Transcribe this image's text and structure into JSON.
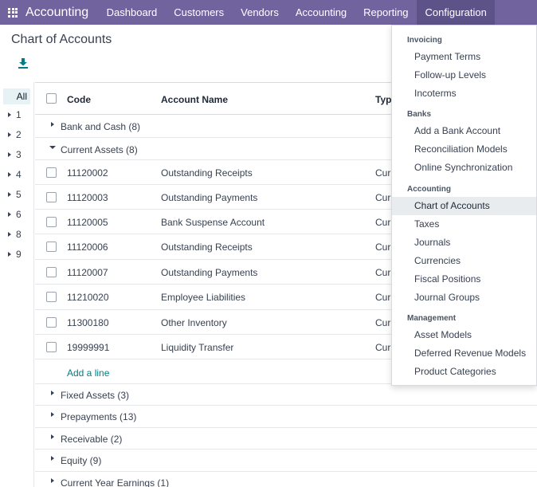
{
  "topbar": {
    "brand": "Accounting",
    "menu": [
      "Dashboard",
      "Customers",
      "Vendors",
      "Accounting",
      "Reporting",
      "Configuration"
    ]
  },
  "page": {
    "title": "Chart of Accounts"
  },
  "sidebar": {
    "all": "All",
    "items": [
      "1",
      "2",
      "3",
      "4",
      "5",
      "6",
      "8",
      "9"
    ]
  },
  "table": {
    "headers": {
      "code": "Code",
      "name": "Account Name",
      "type": "Typ"
    },
    "groups": [
      {
        "label": "Bank and Cash (8)"
      },
      {
        "label": "Current Assets (8)"
      }
    ],
    "rows": [
      {
        "code": "11120002",
        "name": "Outstanding Receipts",
        "type": "Curr"
      },
      {
        "code": "11120003",
        "name": "Outstanding Payments",
        "type": "Curr"
      },
      {
        "code": "11120005",
        "name": "Bank Suspense Account",
        "type": "Curr"
      },
      {
        "code": "11120006",
        "name": "Outstanding Receipts",
        "type": "Curr"
      },
      {
        "code": "11120007",
        "name": "Outstanding Payments",
        "type": "Curr"
      },
      {
        "code": "11210020",
        "name": "Employee Liabilities",
        "type": "Curr"
      },
      {
        "code": "11300180",
        "name": "Other Inventory",
        "type": "Curr"
      },
      {
        "code": "19999991",
        "name": "Liquidity Transfer",
        "type": "Curr"
      }
    ],
    "add_line": "Add a line",
    "more_groups": [
      {
        "label": "Fixed Assets (3)"
      },
      {
        "label": "Prepayments (13)"
      },
      {
        "label": "Receivable (2)"
      },
      {
        "label": "Equity (9)"
      },
      {
        "label": "Current Year Earnings (1)"
      }
    ]
  },
  "dropdown": {
    "sections": [
      {
        "header": "Invoicing",
        "items": [
          "Payment Terms",
          "Follow-up Levels",
          "Incoterms"
        ]
      },
      {
        "header": "Banks",
        "items": [
          "Add a Bank Account",
          "Reconciliation Models",
          "Online Synchronization"
        ]
      },
      {
        "header": "Accounting",
        "items": [
          "Chart of Accounts",
          "Taxes",
          "Journals",
          "Currencies",
          "Fiscal Positions",
          "Journal Groups"
        ]
      },
      {
        "header": "Management",
        "items": [
          "Asset Models",
          "Deferred Revenue Models",
          "Product Categories"
        ]
      }
    ]
  },
  "colors": {
    "topbar": "#71639e",
    "accent": "#017e84"
  }
}
